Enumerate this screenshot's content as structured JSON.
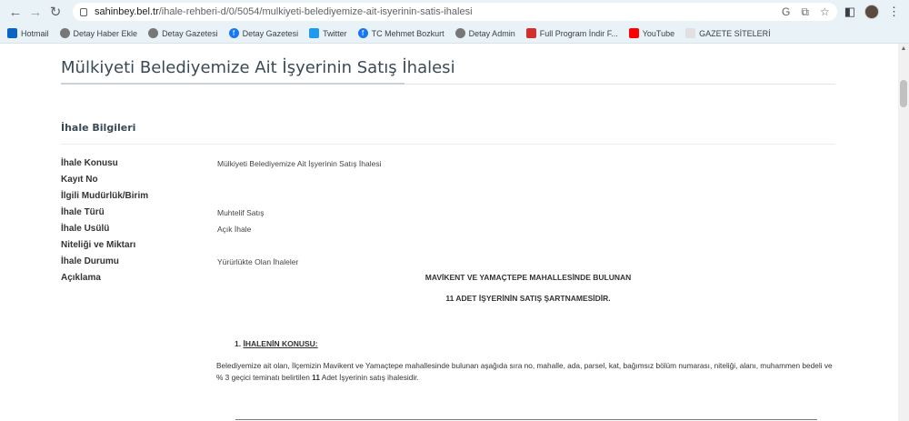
{
  "browser": {
    "url_host": "sahinbey.bel.tr",
    "url_path": "/ihale-rehberi-d/0/5054/mulkiyeti-belediyemize-ait-isyerinin-satis-ihalesi",
    "google_icon": "G"
  },
  "bookmarks": [
    {
      "label": "Hotmail",
      "icon": "outlook-icon",
      "color": "#0a64c8"
    },
    {
      "label": "Detay Haber Ekle",
      "icon": "globe-icon",
      "color": "#777777"
    },
    {
      "label": "Detay Gazetesi",
      "icon": "globe-icon",
      "color": "#777777"
    },
    {
      "label": "Detay Gazetesi",
      "icon": "facebook-icon",
      "color": "#1877f2"
    },
    {
      "label": "Twitter",
      "icon": "twitter-icon",
      "color": "#1d9bf0"
    },
    {
      "label": "TC Mehmet Bozkurt",
      "icon": "facebook-icon",
      "color": "#1877f2"
    },
    {
      "label": "Detay Admin",
      "icon": "globe-icon",
      "color": "#777777"
    },
    {
      "label": "Full Program İndir F...",
      "icon": "program-icon",
      "color": "#d32f2f"
    },
    {
      "label": "YouTube",
      "icon": "youtube-icon",
      "color": "#ff0000"
    },
    {
      "label": "GAZETE SİTELERİ",
      "icon": "folder-icon",
      "color": "#e0e0e0"
    }
  ],
  "page": {
    "title": "Mülkiyeti Belediyemize Ait İşyerinin Satış İhalesi",
    "section_title": "İhale Bilgileri",
    "rows": [
      {
        "label": "İhale Konusu",
        "value": "Mülkiyeti Belediyemize Ait İşyerinin Satış İhalesi"
      },
      {
        "label": "Kayıt No",
        "value": ""
      },
      {
        "label": "İlgili Mudürlük/Birim",
        "value": ""
      },
      {
        "label": "İhale Türü",
        "value": "Muhtelif Satış"
      },
      {
        "label": "İhale Usülü",
        "value": "Açık İhale"
      },
      {
        "label": "Niteliği ve Miktarı",
        "value": ""
      },
      {
        "label": "İhale Durumu",
        "value": "Yürürlükte Olan İhaleler"
      },
      {
        "label": "Açıklama",
        "value": ""
      }
    ],
    "description": {
      "heading1": "MAVİKENT VE YAMAÇTEPE MAHALLESİNDE BULUNAN",
      "heading2": "11 ADET İŞYERİNİN SATIŞ ŞARTNAMESİDİR.",
      "item_number": "1.",
      "item_title": "İHALENİN KONUSU:",
      "paragraph_start": "Belediyemize ait olan, İlçemizin Mavikent ve Yamaçtepe mahallesinde bulunan aşağıda sıra no, mahalle, ada, parsel, kat, bağımsız bölüm numarası, niteliği, alanı, muhammen bedeli ve % 3 geçici teminatı belirtilen ",
      "paragraph_bold": "11",
      "paragraph_end": " Adet İşyerinin satış ihalesidir."
    }
  }
}
